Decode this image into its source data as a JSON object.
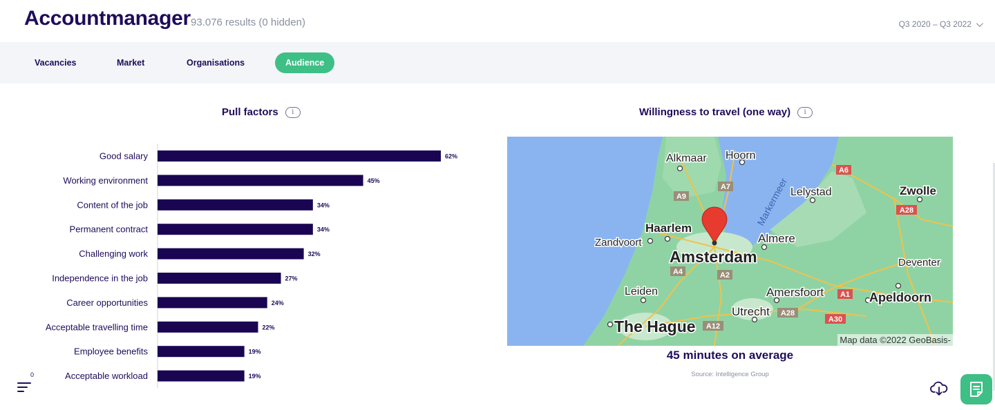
{
  "header": {
    "title": "Accountmanager",
    "results": "93.076 results (0 hidden)",
    "date_range": "Q3 2020 – Q3 2022"
  },
  "tabs": [
    {
      "label": "Vacancies",
      "active": false
    },
    {
      "label": "Market",
      "active": false
    },
    {
      "label": "Organisations",
      "active": false
    },
    {
      "label": "Audience",
      "active": true
    }
  ],
  "pull_factors": {
    "title": "Pull factors",
    "info_glyph": "i",
    "chart_data": {
      "type": "bar",
      "orientation": "horizontal",
      "title": "Pull factors",
      "categories": [
        "Good salary",
        "Working environment",
        "Content of the job",
        "Permanent contract",
        "Challenging work",
        "Independence in the job",
        "Career opportunities",
        "Acceptable travelling time",
        "Employee benefits",
        "Acceptable workload"
      ],
      "values": [
        62,
        45,
        34,
        34,
        32,
        27,
        24,
        22,
        19,
        19
      ],
      "value_labels": [
        "62%",
        "45%",
        "34%",
        "34%",
        "32%",
        "27%",
        "24%",
        "22%",
        "19%",
        "19%"
      ],
      "unit": "%",
      "bar_color": "#1a0552",
      "grid": false,
      "legend": "none"
    }
  },
  "travel": {
    "title": "Willingness to travel (one way)",
    "info_glyph": "i",
    "map": {
      "cities": [
        "Alkmaar",
        "Hoorn",
        "Lelystad",
        "Zwolle",
        "Haarlem",
        "Zandvoort",
        "Almere",
        "Amsterdam",
        "Deventer",
        "Leiden",
        "Amersfoort",
        "Apeldoorn",
        "Utrecht",
        "The Hague"
      ],
      "water_label": "Markermeer",
      "roads": [
        "A6",
        "A7",
        "A9",
        "A28",
        "A4",
        "A2",
        "A1",
        "A12",
        "A28",
        "A30"
      ],
      "attribution": "Map data ©2022 GeoBasis-",
      "colors": {
        "land": "#8fd3a4",
        "water": "#8ab4f0",
        "marker": "#e63b2e"
      }
    },
    "average": "45 minutes on average",
    "source": "Source: Intelligence Group"
  },
  "controls": {
    "filter_count": "0"
  }
}
